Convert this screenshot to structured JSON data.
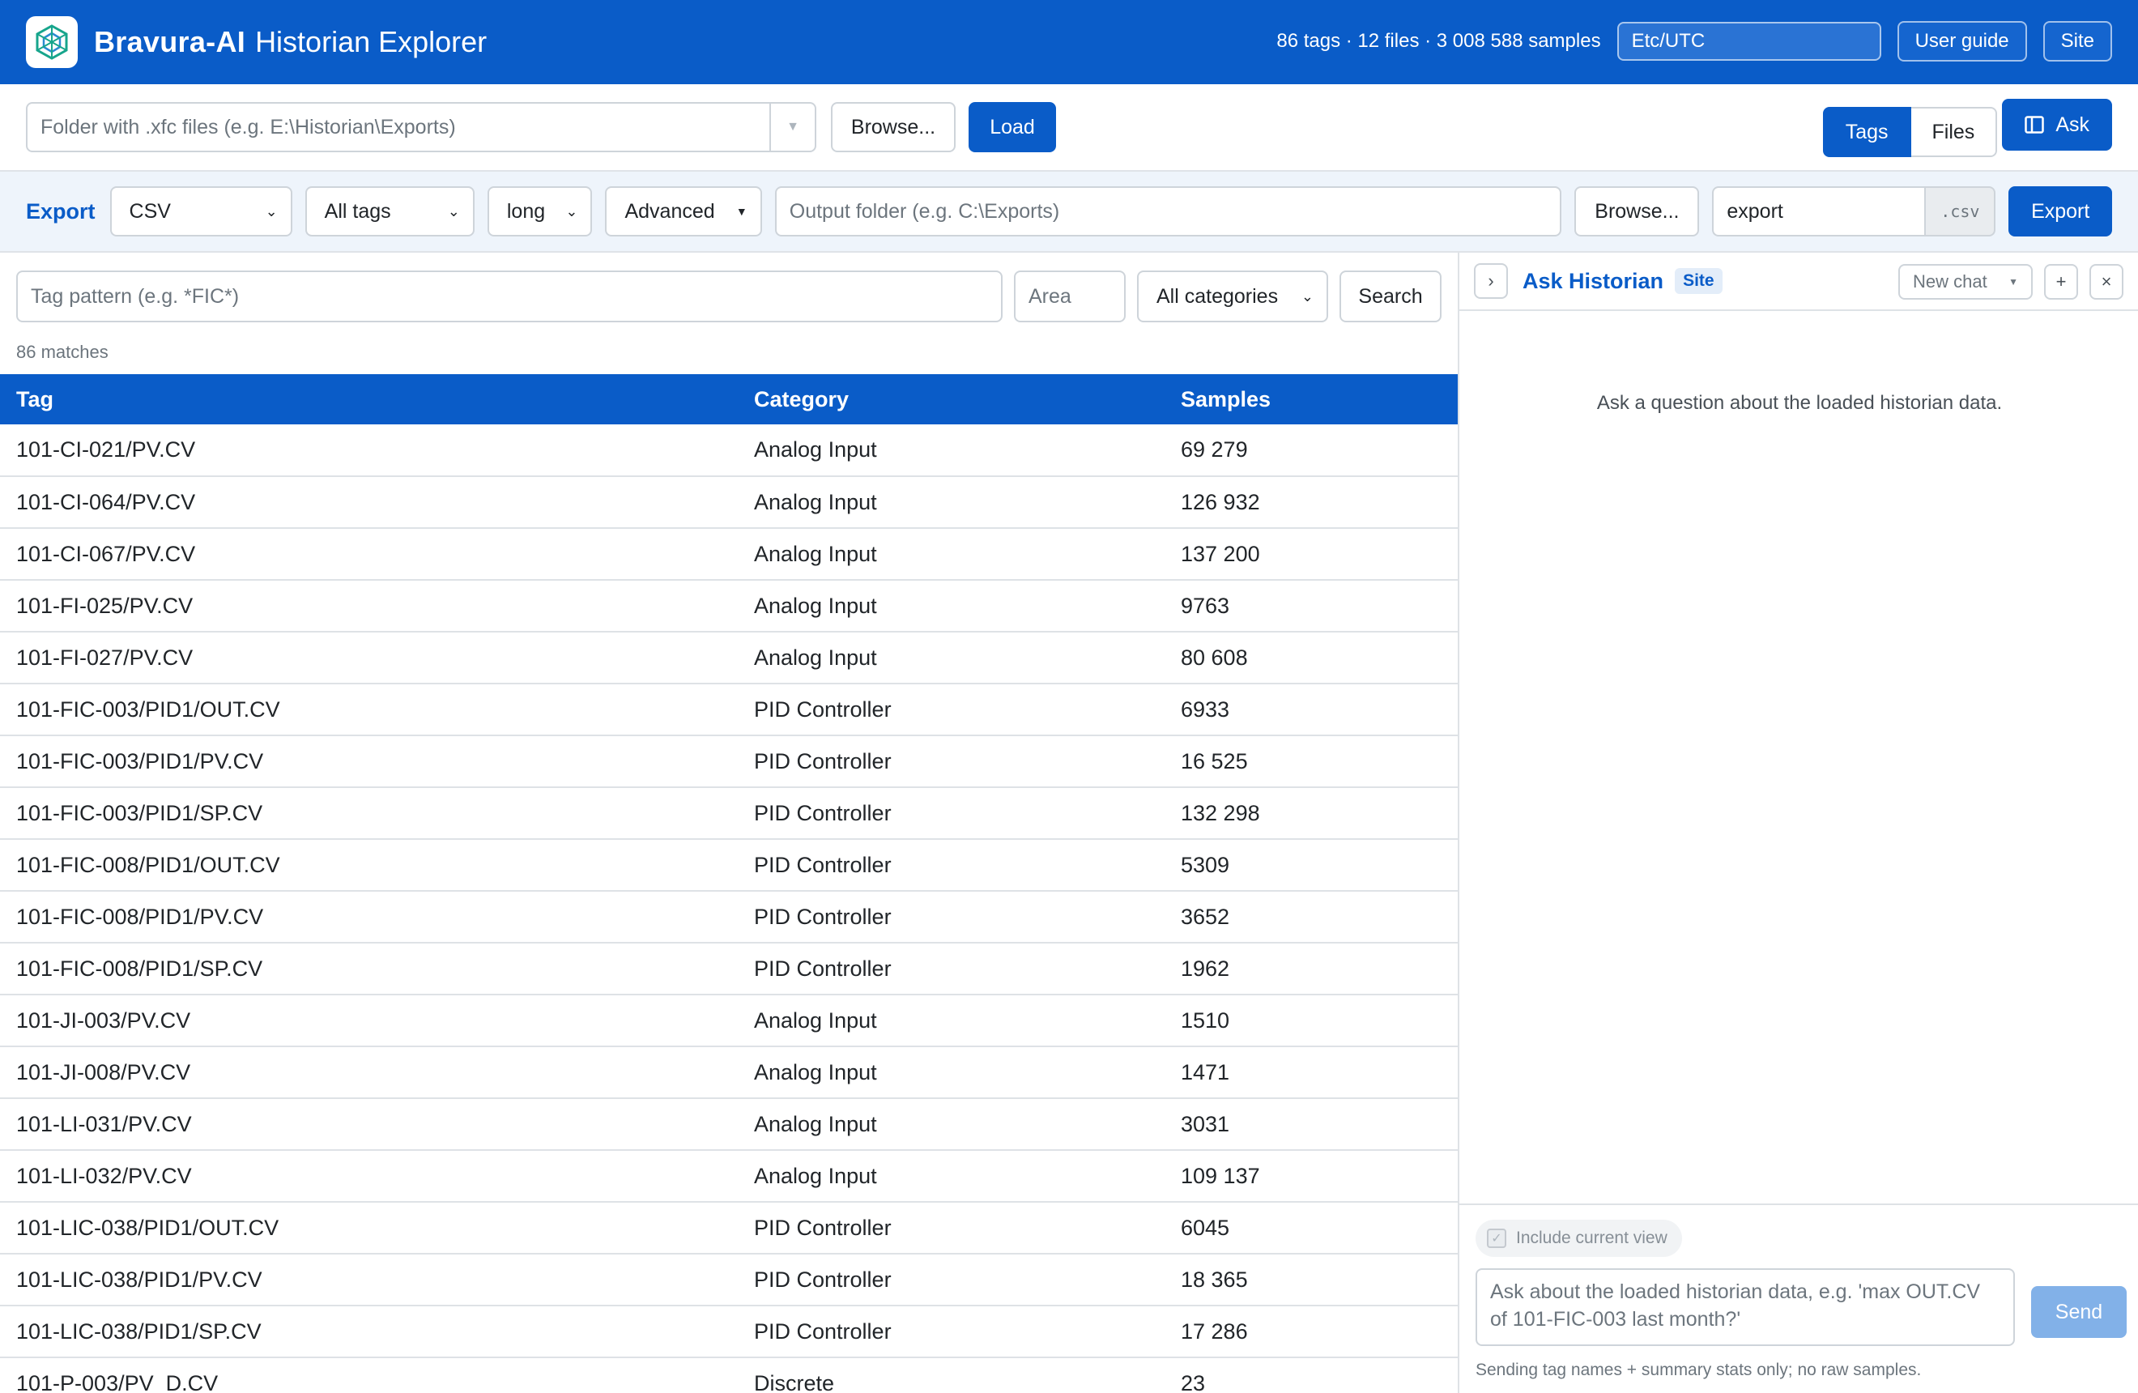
{
  "header": {
    "brand": "Bravura-AI",
    "subtitle": "Historian Explorer",
    "stats": "86 tags · 12 files · 3 008 588 samples",
    "timezone": "Etc/UTC",
    "user_guide_label": "User guide",
    "site_label": "Site",
    "accent_color": "#0a5cc8"
  },
  "loadbar": {
    "folder_placeholder": "Folder with .xfc files (e.g. E:\\Historian\\Exports)",
    "browse_label": "Browse...",
    "load_label": "Load",
    "tabs": [
      "Tags",
      "Files"
    ],
    "active_tab": "Tags",
    "ask_label": "Ask"
  },
  "export": {
    "label": "Export",
    "format": "CSV",
    "scope": "All tags",
    "layout": "long",
    "advanced_label": "Advanced",
    "output_placeholder": "Output folder (e.g. C:\\Exports)",
    "browse_label": "Browse...",
    "filename": "export",
    "extension": ".csv",
    "export_label": "Export"
  },
  "search": {
    "pattern_placeholder": "Tag pattern (e.g. *FIC*)",
    "area_placeholder": "Area",
    "category": "All categories",
    "search_label": "Search",
    "match_count": "86 matches"
  },
  "table": {
    "columns": [
      "Tag",
      "Category",
      "Samples"
    ],
    "rows": [
      [
        "101-CI-021/PV.CV",
        "Analog Input",
        "69 279"
      ],
      [
        "101-CI-064/PV.CV",
        "Analog Input",
        "126 932"
      ],
      [
        "101-CI-067/PV.CV",
        "Analog Input",
        "137 200"
      ],
      [
        "101-FI-025/PV.CV",
        "Analog Input",
        "9763"
      ],
      [
        "101-FI-027/PV.CV",
        "Analog Input",
        "80 608"
      ],
      [
        "101-FIC-003/PID1/OUT.CV",
        "PID Controller",
        "6933"
      ],
      [
        "101-FIC-003/PID1/PV.CV",
        "PID Controller",
        "16 525"
      ],
      [
        "101-FIC-003/PID1/SP.CV",
        "PID Controller",
        "132 298"
      ],
      [
        "101-FIC-008/PID1/OUT.CV",
        "PID Controller",
        "5309"
      ],
      [
        "101-FIC-008/PID1/PV.CV",
        "PID Controller",
        "3652"
      ],
      [
        "101-FIC-008/PID1/SP.CV",
        "PID Controller",
        "1962"
      ],
      [
        "101-JI-003/PV.CV",
        "Analog Input",
        "1510"
      ],
      [
        "101-JI-008/PV.CV",
        "Analog Input",
        "1471"
      ],
      [
        "101-LI-031/PV.CV",
        "Analog Input",
        "3031"
      ],
      [
        "101-LI-032/PV.CV",
        "Analog Input",
        "109 137"
      ],
      [
        "101-LIC-038/PID1/OUT.CV",
        "PID Controller",
        "6045"
      ],
      [
        "101-LIC-038/PID1/PV.CV",
        "PID Controller",
        "18 365"
      ],
      [
        "101-LIC-038/PID1/SP.CV",
        "PID Controller",
        "17 286"
      ],
      [
        "101-P-003/PV_D.CV",
        "Discrete",
        "23"
      ]
    ]
  },
  "ask": {
    "title": "Ask Historian",
    "badge": "Site",
    "new_chat_label": "New chat",
    "empty_message": "Ask a question about the loaded historian data.",
    "include_label": "Include current view",
    "input_placeholder": "Ask about the loaded historian data, e.g. 'max OUT.CV of 101-FIC-003 last month?'",
    "send_label": "Send",
    "note": "Sending tag names + summary stats only; no raw samples."
  }
}
